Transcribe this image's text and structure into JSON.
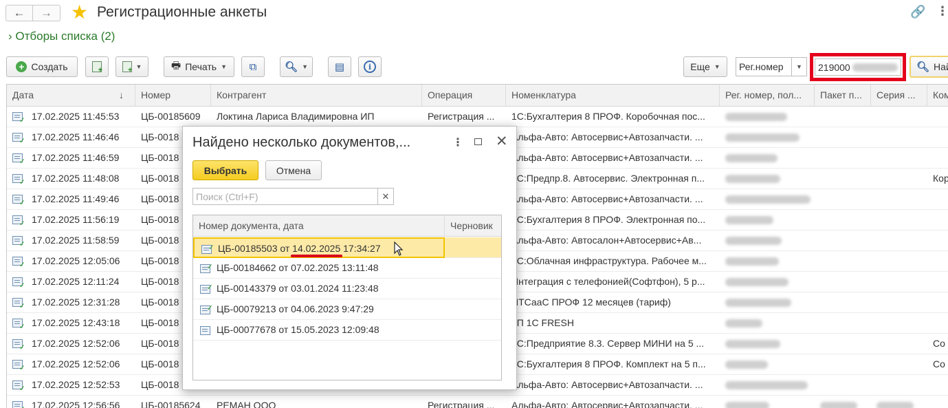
{
  "header": {
    "title": "Регистрационные анкеты",
    "filters_label": "Отборы списка (2)"
  },
  "toolbar": {
    "create": "Создать",
    "print": "Печать",
    "more": "Еще",
    "field_select": "Рег.номер",
    "search_value": "219000",
    "find": "Най"
  },
  "table": {
    "columns": [
      "Дата",
      "Номер",
      "Контрагент",
      "Операция",
      "Номенклатура",
      "Рег. номер, пол...",
      "Пакет п...",
      "Серия ...",
      "Ком"
    ],
    "rows": [
      {
        "date": "17.02.2025 11:45:53",
        "num": "ЦБ-00185609",
        "agent": "Локтина Лариса Владимировна ИП",
        "op": "Регистрация ...",
        "nom": "1С:Бухгалтерия 8 ПРОФ. Коробочная пос...",
        "extra": ""
      },
      {
        "date": "17.02.2025 11:46:46",
        "num": "ЦБ-0018",
        "agent": "",
        "op": "",
        "nom": "Альфа-Авто: Автосервис+Автозапчасти. ...",
        "extra": ""
      },
      {
        "date": "17.02.2025 11:46:59",
        "num": "ЦБ-0018",
        "agent": "",
        "op": "",
        "nom": "Альфа-Авто: Автосервис+Автозапчасти. ...",
        "extra": ""
      },
      {
        "date": "17.02.2025 11:48:08",
        "num": "ЦБ-0018",
        "agent": "",
        "op": "",
        "nom": "1С:Предпр.8. Автосервис. Электронная п...",
        "extra": "Кор"
      },
      {
        "date": "17.02.2025 11:49:46",
        "num": "ЦБ-0018",
        "agent": "",
        "op": "",
        "nom": "Альфа-Авто: Автосервис+Автозапчасти. ...",
        "extra": ""
      },
      {
        "date": "17.02.2025 11:56:19",
        "num": "ЦБ-0018",
        "agent": "",
        "op": "",
        "nom": "1С:Бухгалтерия 8 ПРОФ. Электронная по...",
        "extra": ""
      },
      {
        "date": "17.02.2025 11:58:59",
        "num": "ЦБ-0018",
        "agent": "",
        "op": "",
        "nom": "Альфа-Авто: Автосалон+Автосервис+Ав...",
        "extra": ""
      },
      {
        "date": "17.02.2025 12:05:06",
        "num": "ЦБ-0018",
        "agent": "",
        "op": "",
        "nom": "1С:Облачная инфраструктура. Рабочее м...",
        "extra": ""
      },
      {
        "date": "17.02.2025 12:11:24",
        "num": "ЦБ-0018",
        "agent": "",
        "op": "",
        "nom": "Интеграция с телефонией(Софтфон), 5 р...",
        "extra": ""
      },
      {
        "date": "17.02.2025 12:31:28",
        "num": "ЦБ-0018",
        "agent": "",
        "op": "",
        "nom": "ИТСааС ПРОФ 12 месяцев (тариф)",
        "extra": ""
      },
      {
        "date": "17.02.2025 12:43:18",
        "num": "ЦБ-0018",
        "agent": "",
        "op": "",
        "nom": "1П 1С FRESH",
        "extra": ""
      },
      {
        "date": "17.02.2025 12:52:06",
        "num": "ЦБ-0018",
        "agent": "",
        "op": "",
        "nom": "1С:Предприятие 8.3. Сервер МИНИ на 5 ...",
        "extra": "Со"
      },
      {
        "date": "17.02.2025 12:52:06",
        "num": "ЦБ-0018",
        "agent": "",
        "op": "",
        "nom": "1С:Бухгалтерия 8 ПРОФ. Комплект на 5 п...",
        "extra": "Со"
      },
      {
        "date": "17.02.2025 12:52:53",
        "num": "ЦБ-0018",
        "agent": "",
        "op": "",
        "nom": "Альфа-Авто: Автосервис+Автозапчасти. ...",
        "extra": ""
      },
      {
        "date": "17.02.2025 12:56:56",
        "num": "ЦБ-00185624",
        "agent": "РЕМАН ООО",
        "op": "Регистрация ...",
        "nom": "Альфа-Авто: Автосервис+Автозапчасти. ...",
        "extra": ""
      }
    ]
  },
  "dialog": {
    "title": "Найдено несколько документов,...",
    "select": "Выбрать",
    "cancel": "Отмена",
    "search_placeholder": "Поиск (Ctrl+F)",
    "col_doc": "Номер документа, дата",
    "col_draft": "Черновик",
    "items": [
      "ЦБ-00185503 от 14.02.2025 17:34:27",
      "ЦБ-00184662 от 07.02.2025 13:11:48",
      "ЦБ-00143379 от 03.01.2024 11:23:48",
      "ЦБ-00079213 от 04.06.2023 9:47:29",
      "ЦБ-00077678 от 15.05.2023 12:09:48"
    ]
  }
}
